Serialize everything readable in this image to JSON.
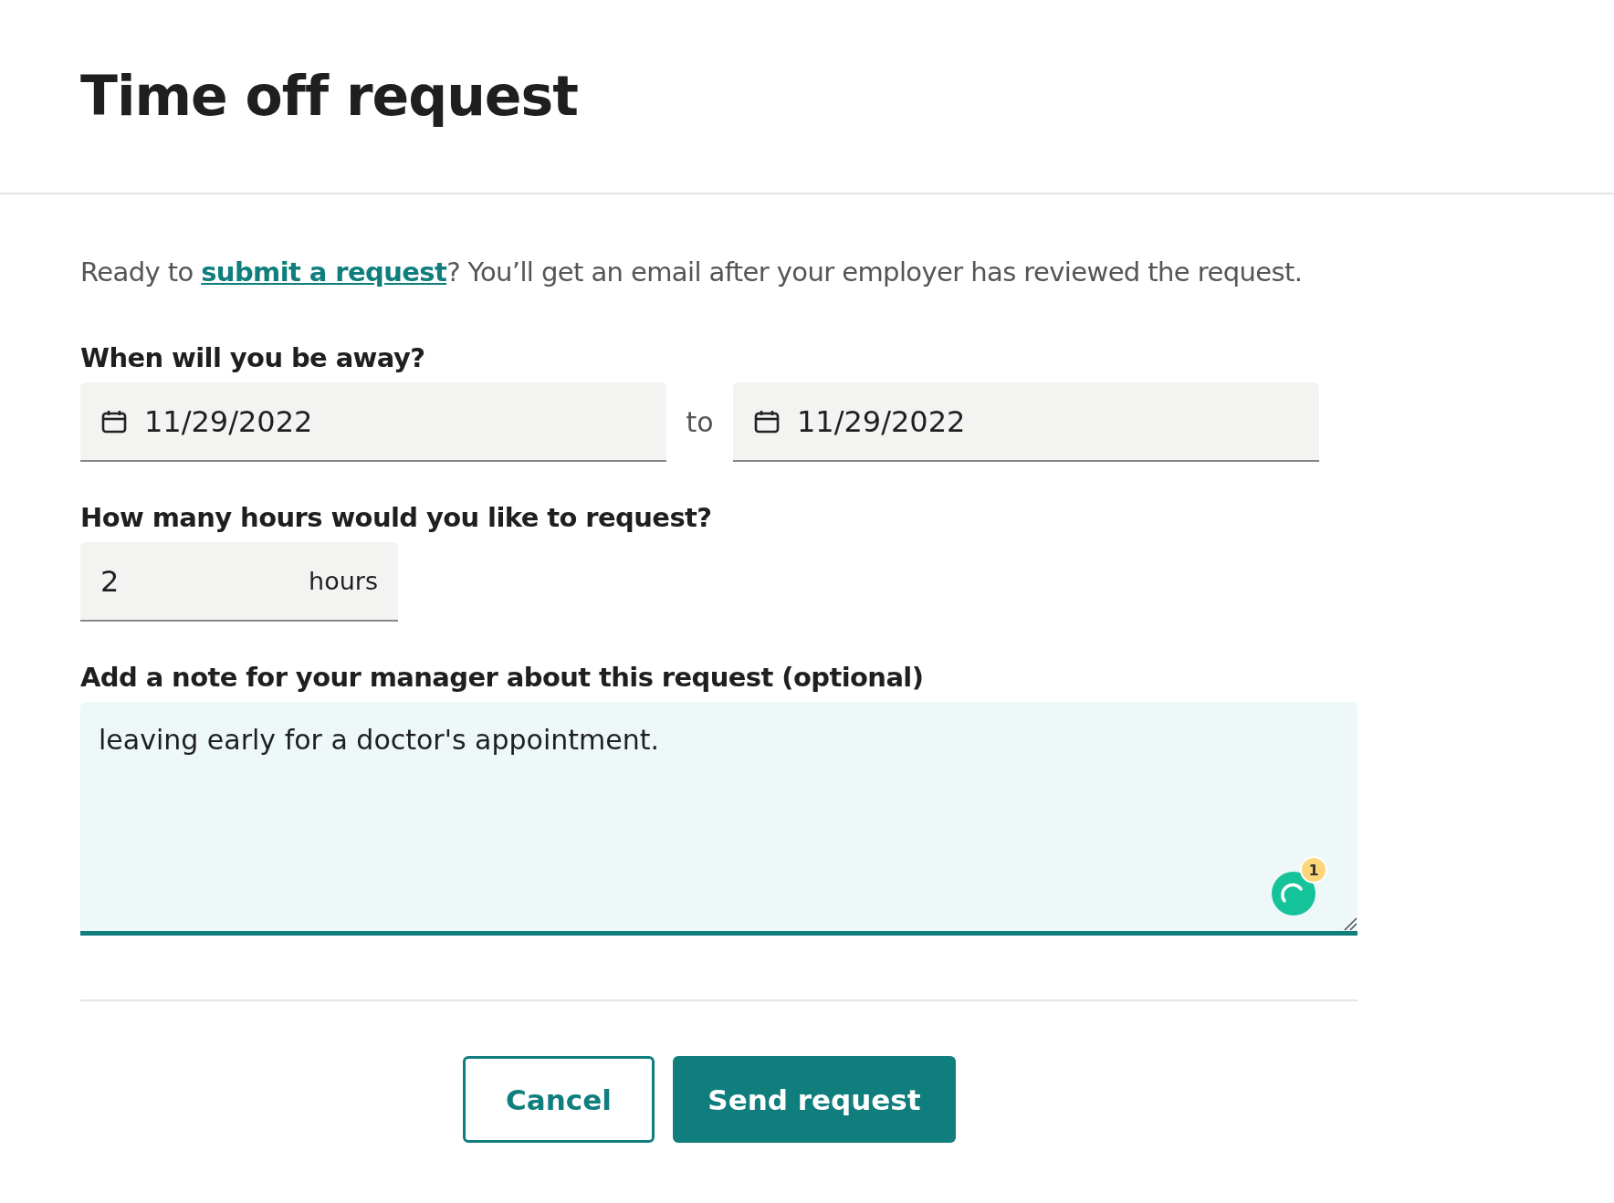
{
  "header": {
    "title": "Time off request"
  },
  "intro": {
    "before": "Ready to ",
    "link": "submit a request",
    "after": "? You’ll get an email after your employer has reviewed the request."
  },
  "dates": {
    "label": "When will you be away?",
    "start": "11/29/2022",
    "separator": "to",
    "end": "11/29/2022"
  },
  "hours": {
    "label": "How many hours would you like to request?",
    "value": "2",
    "unit": "hours"
  },
  "note": {
    "label": "Add a note for your manager about this request (optional)",
    "value": "leaving early for a doctor's appointment.",
    "assistant_badge": "1"
  },
  "buttons": [
    {
      "label": "Cancel",
      "kind": "secondary"
    },
    {
      "label": "Send request",
      "kind": "primary"
    }
  ]
}
